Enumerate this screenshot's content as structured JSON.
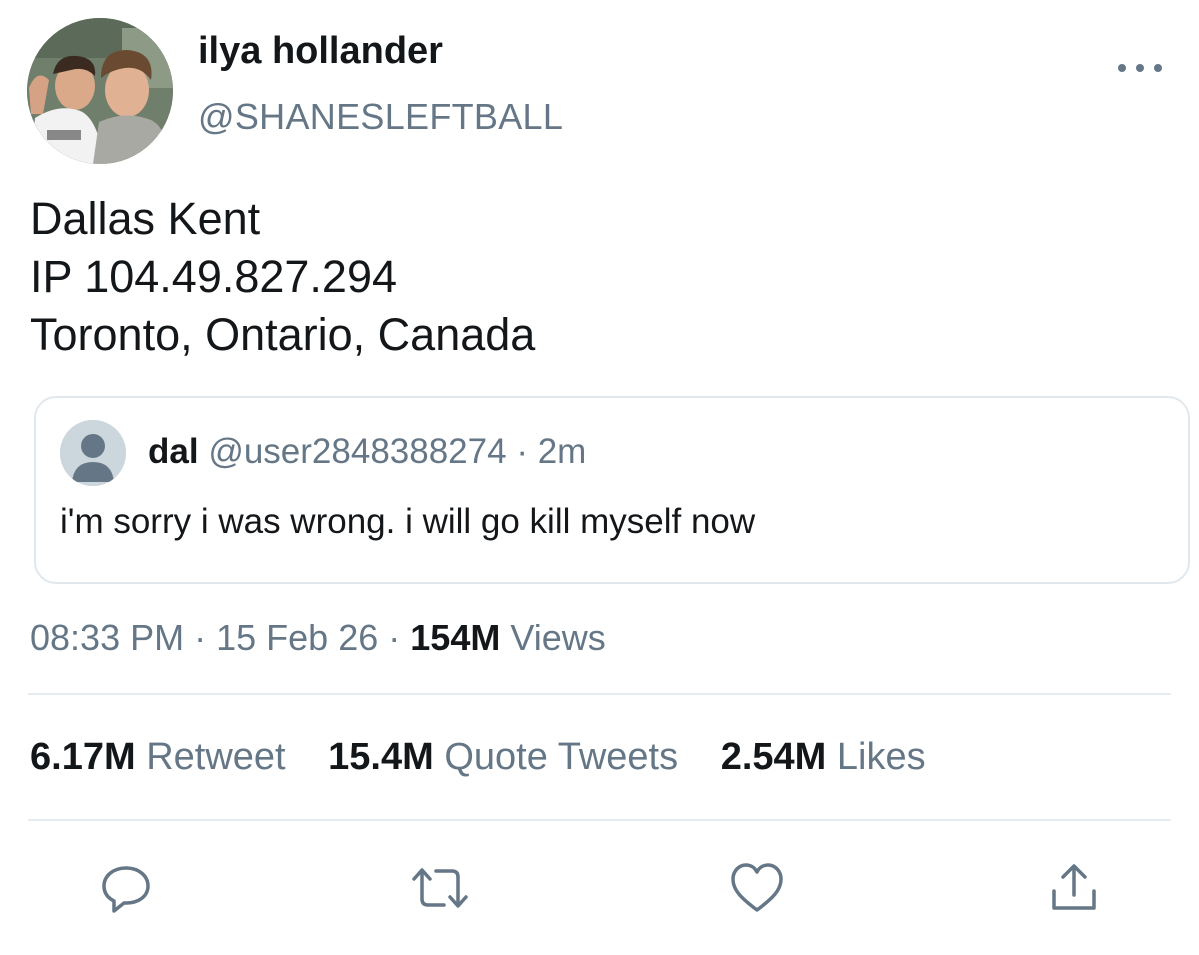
{
  "author": {
    "display_name": "ilya hollander",
    "handle": "@SHANESLEFTBALL",
    "avatar_icon": "profile-photo"
  },
  "tweet": {
    "lines": [
      "Dallas Kent",
      "IP 104.49.827.294",
      "Toronto, Ontario, Canada"
    ]
  },
  "quoted_tweet": {
    "name": "dal",
    "handle": "@user2848388274",
    "separator": "·",
    "time": "2m",
    "text": "i'm sorry i was wrong. i will go kill myself now",
    "avatar_icon": "default-user-icon"
  },
  "meta": {
    "time": "08:33 PM",
    "sep1": "·",
    "date": "15 Feb 26",
    "sep2": "·",
    "views_count": "154M",
    "views_label": "Views"
  },
  "stats": {
    "retweets_count": "6.17M",
    "retweets_label": "Retweet",
    "quotes_count": "15.4M",
    "quotes_label": "Quote Tweets",
    "likes_count": "2.54M",
    "likes_label": "Likes"
  },
  "actions": [
    "reply-icon",
    "retweet-icon",
    "like-icon",
    "share-icon"
  ],
  "colors": {
    "text": "#14171a",
    "secondary": "#657786",
    "border": "#e1e8ed"
  }
}
